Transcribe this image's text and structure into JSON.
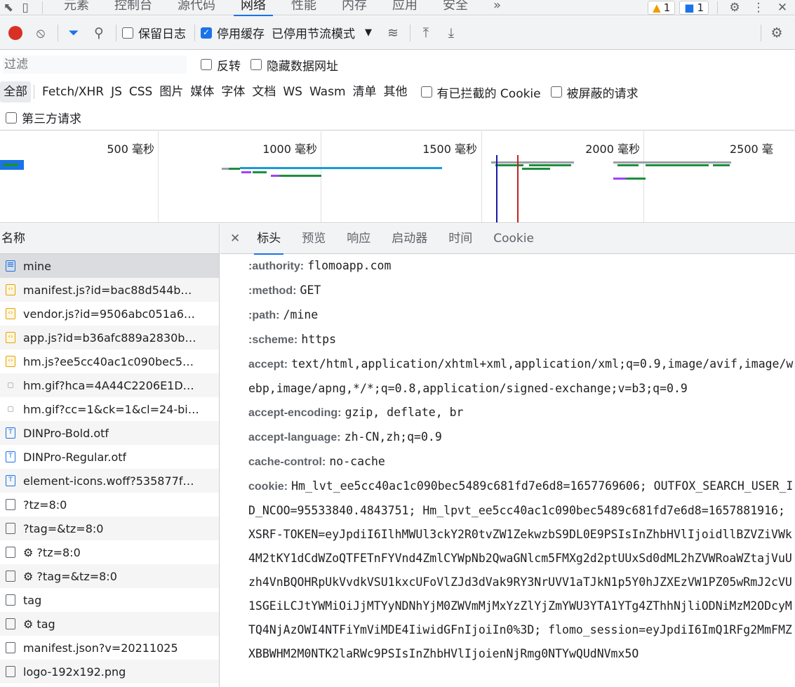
{
  "tabbar": {
    "panels": [
      "元素",
      "控制台",
      "源代码",
      "网络",
      "性能",
      "内存",
      "应用",
      "安全"
    ],
    "active_index": 3,
    "more": "»",
    "warnings": "1",
    "messages": "1"
  },
  "toolbar": {
    "preserve_log": "保留日志",
    "disable_cache": "停用缓存",
    "throttling": "已停用节流模式"
  },
  "filter": {
    "placeholder": "过滤",
    "invert": "反转",
    "hide_data_urls": "隐藏数据网址",
    "types": [
      "全部",
      "Fetch/XHR",
      "JS",
      "CSS",
      "图片",
      "媒体",
      "字体",
      "文档",
      "WS",
      "Wasm",
      "清单",
      "其他"
    ],
    "blocked_cookies": "有已拦截的 Cookie",
    "blocked_requests": "被屏蔽的请求",
    "third_party": "第三方请求"
  },
  "overview": {
    "ticks": [
      "500 毫秒",
      "1000 毫秒",
      "1500 毫秒",
      "2000 毫秒",
      "2500 毫"
    ]
  },
  "list": {
    "header": "名称",
    "rows": [
      {
        "name": "mine",
        "kind": "doc"
      },
      {
        "name": "manifest.js?id=bac88d544b…",
        "kind": "js"
      },
      {
        "name": "vendor.js?id=9506abc051a6…",
        "kind": "js"
      },
      {
        "name": "app.js?id=b36afc889a2830b…",
        "kind": "js"
      },
      {
        "name": "hm.js?ee5cc40ac1c090bec5…",
        "kind": "js"
      },
      {
        "name": "hm.gif?hca=4A44C2206E1D…",
        "kind": "img"
      },
      {
        "name": "hm.gif?cc=1&ck=1&cl=24-bi…",
        "kind": "img"
      },
      {
        "name": "DINPro-Bold.otf",
        "kind": "font"
      },
      {
        "name": "DINPro-Regular.otf",
        "kind": "font"
      },
      {
        "name": "element-icons.woff?535877f…",
        "kind": "font"
      },
      {
        "name": "?tz=8:0",
        "kind": "plain"
      },
      {
        "name": "?tag=&tz=8:0",
        "kind": "plain"
      },
      {
        "name": "⚙ ?tz=8:0",
        "kind": "plain"
      },
      {
        "name": "⚙ ?tag=&tz=8:0",
        "kind": "plain"
      },
      {
        "name": "tag",
        "kind": "plain"
      },
      {
        "name": "⚙ tag",
        "kind": "plain"
      },
      {
        "name": "manifest.json?v=20211025",
        "kind": "plain"
      },
      {
        "name": "logo-192x192.png",
        "kind": "plain"
      }
    ]
  },
  "detail": {
    "tabs": [
      "标头",
      "预览",
      "响应",
      "启动器",
      "时间",
      "Cookie"
    ],
    "active_index": 0,
    "headers": [
      {
        "key": ":authority:",
        "value": "flomoapp.com"
      },
      {
        "key": ":method:",
        "value": "GET"
      },
      {
        "key": ":path:",
        "value": "/mine"
      },
      {
        "key": ":scheme:",
        "value": "https"
      },
      {
        "key": "accept:",
        "value": "text/html,application/xhtml+xml,application/xml;q=0.9,image/avif,image/webp,image/apng,*/*;q=0.8,application/signed-exchange;v=b3;q=0.9"
      },
      {
        "key": "accept-encoding:",
        "value": "gzip, deflate, br"
      },
      {
        "key": "accept-language:",
        "value": "zh-CN,zh;q=0.9"
      },
      {
        "key": "cache-control:",
        "value": "no-cache"
      },
      {
        "key": "cookie:",
        "value": "Hm_lvt_ee5cc40ac1c090bec5489c681fd7e6d8=1657769606; OUTFOX_SEARCH_USER_ID_NCOO=95533840.4843751; Hm_lpvt_ee5cc40ac1c090bec5489c681fd7e6d8=1657881916; XSRF-TOKEN=eyJpdiI6IlhMWUl3ckY2R0tvZW1ZekwzbS9DL0E9PSIsInZhbHVlIjoidllBZVZiVWk4M2tKY1dCdWZoQTFETnFYVnd4ZmlCYWpNb2QwaGNlcm5FMXg2d2ptUUxSd0dML2hZVWRoaWZtajVuUzh4VnBQOHRpUkVvdkVSU1kxcUFoVlZJd3dVak9RY3NrUVV1aTJkN1p5Y0hJZXEzVW1PZ05wRmJ2cVU1SGEiLCJtYWMiOiJjMTYyNDNhYjM0ZWVmMjMxYzZlYjZmYWU3YTA1YTg4ZThhNjliODNiMzM2ODcyMTQ4NjAzOWI4NTFiYmViMDE4IiwidGFnIjoiIn0%3D; flomo_session=eyJpdiI6ImQ1RFg2MmFMZXBBWHM2M0NTK2laRWc9PSIsInZhbHVlIjoienNjRmg0NTYwQUdNVmx5O"
      }
    ]
  }
}
